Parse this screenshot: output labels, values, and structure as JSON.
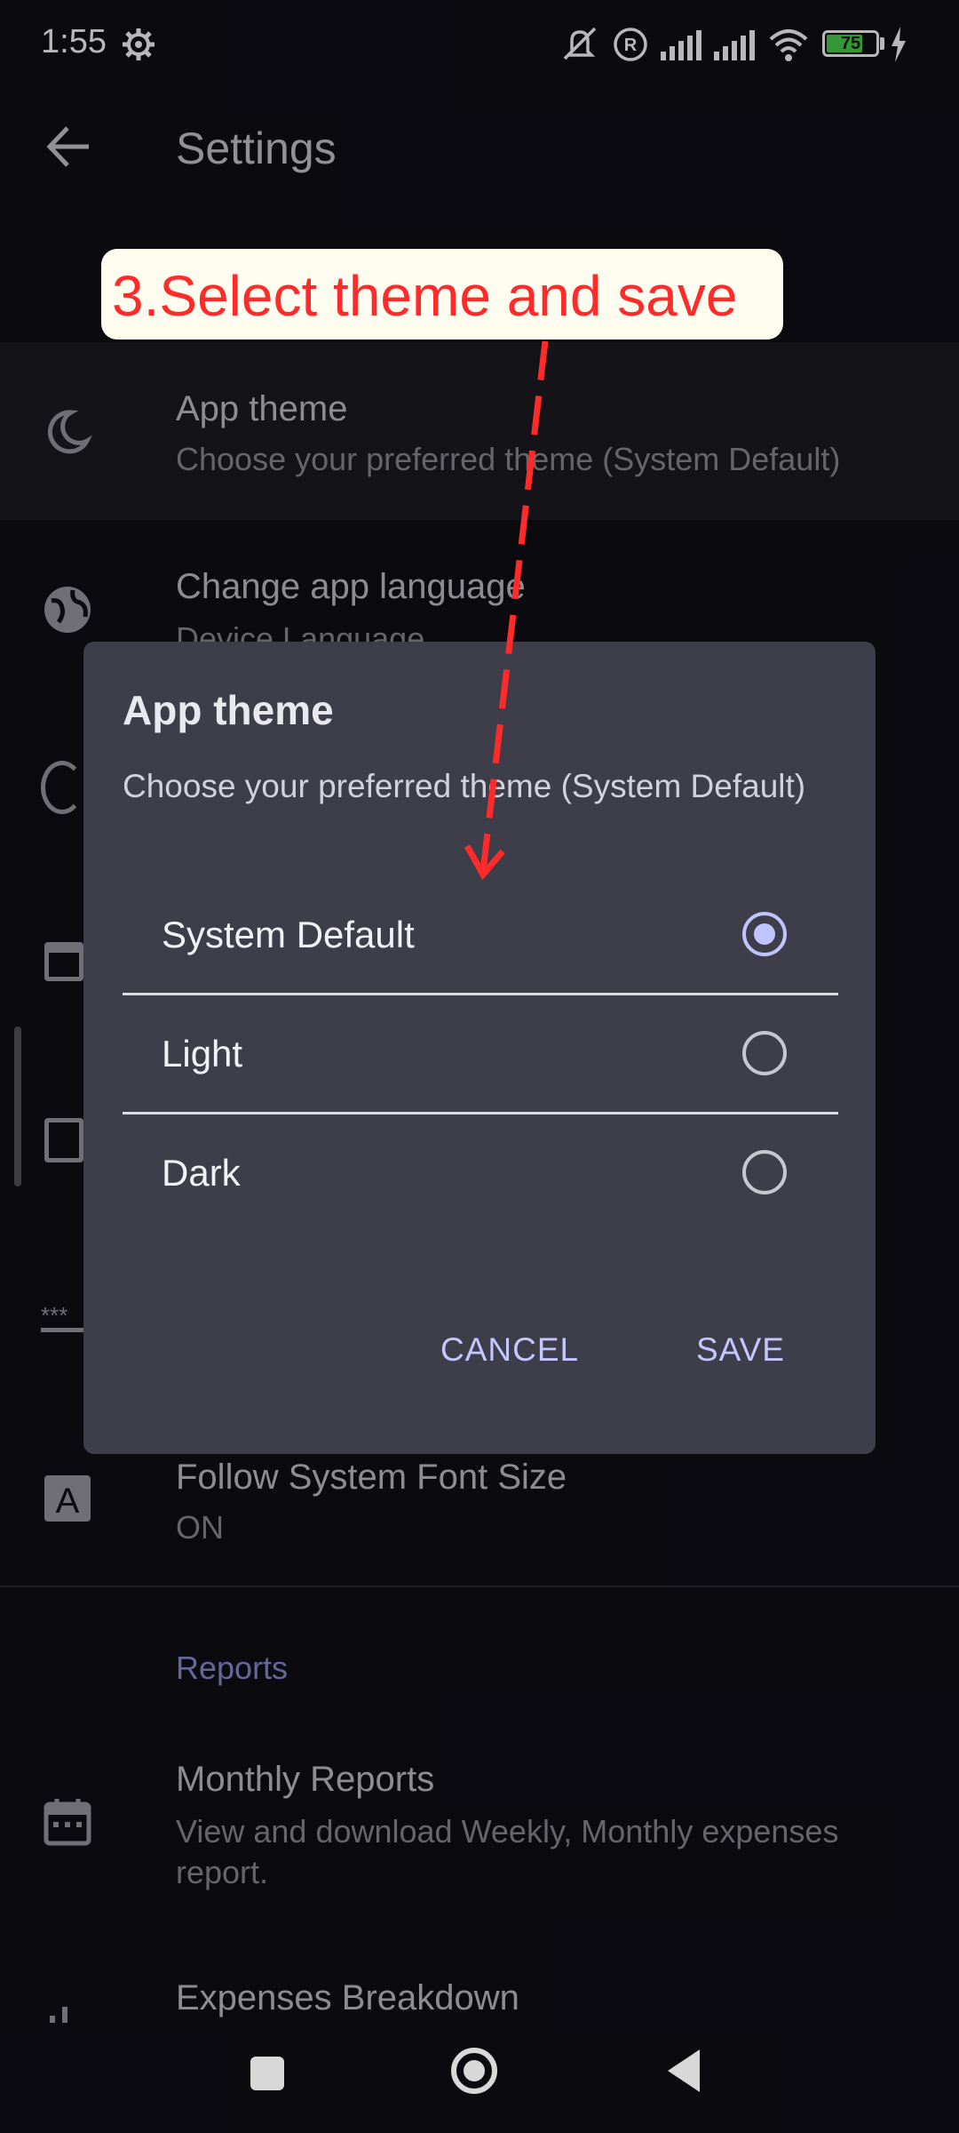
{
  "status_bar": {
    "time": "1:55",
    "battery": "75",
    "battery_level": 0.75,
    "icons": [
      "gear-icon",
      "mute-icon",
      "registered-icon",
      "signal-icon",
      "signal-icon",
      "wifi-icon",
      "battery-icon",
      "charging-icon"
    ]
  },
  "app_bar": {
    "title": "Settings",
    "back_icon": "arrow-back-icon"
  },
  "annotation": {
    "text": "3.Select theme and save",
    "color": "#ff2b2b"
  },
  "settings_list": {
    "items": [
      {
        "title": "App theme",
        "subtitle": "Choose your preferred theme (System Default)",
        "icon": "moon-icon"
      },
      {
        "title": "Change app language",
        "subtitle": "Device Language",
        "icon": "globe-icon"
      },
      {
        "title": "Follow System Font Size",
        "subtitle": "ON",
        "icon": "font-size-icon"
      }
    ],
    "section_reports": "Reports",
    "reports": [
      {
        "title": "Monthly Reports",
        "subtitle": "View and download Weekly, Monthly expenses report.",
        "icon": "calendar-icon"
      },
      {
        "title": "Expenses Breakdown",
        "icon": "bar-chart-icon"
      }
    ]
  },
  "dialog": {
    "title": "App theme",
    "subtitle": "Choose your preferred theme (System Default)",
    "options": [
      {
        "label": "System Default",
        "selected": true
      },
      {
        "label": "Light",
        "selected": false
      },
      {
        "label": "Dark",
        "selected": false
      }
    ],
    "cancel_label": "CANCEL",
    "save_label": "SAVE",
    "accent_color": "#c0c4ff"
  },
  "nav_bar": {
    "icons": [
      "recents-icon",
      "home-icon",
      "back-icon"
    ]
  }
}
